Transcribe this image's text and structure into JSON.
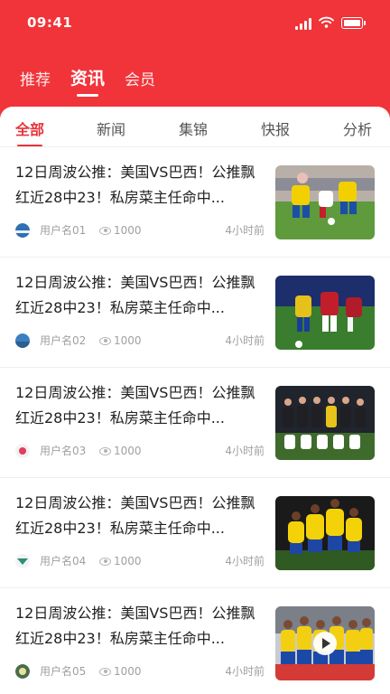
{
  "status_bar": {
    "time": "09:41"
  },
  "top_tabs": [
    {
      "label": "推荐",
      "active": false
    },
    {
      "label": "资讯",
      "active": true
    },
    {
      "label": "会员",
      "active": false
    }
  ],
  "categories": [
    {
      "label": "全部",
      "active": true
    },
    {
      "label": "新闻",
      "active": false
    },
    {
      "label": "集锦",
      "active": false
    },
    {
      "label": "快报",
      "active": false
    },
    {
      "label": "分析",
      "active": false
    }
  ],
  "articles": [
    {
      "title": "12日周波公推：美国VS巴西！公推飘红近28中23！私房菜主任命中...",
      "user": "用户名01",
      "views": "1000",
      "time": "4小时前",
      "thumb": "soccer-yellow-players",
      "video": false
    },
    {
      "title": "12日周波公推：美国VS巴西！公推飘红近28中23！私房菜主任命中...",
      "user": "用户名02",
      "views": "1000",
      "time": "4小时前",
      "thumb": "soccer-red-vs-yellow",
      "video": false
    },
    {
      "title": "12日周波公推：美国VS巴西！公推飘红近28中23！私房菜主任命中...",
      "user": "用户名03",
      "views": "1000",
      "time": "4小时前",
      "thumb": "team-photo",
      "video": false
    },
    {
      "title": "12日周波公推：美国VS巴西！公推飘红近28中23！私房菜主任命中...",
      "user": "用户名04",
      "views": "1000",
      "time": "4小时前",
      "thumb": "celebration-huddle",
      "video": false
    },
    {
      "title": "12日周波公推：美国VS巴西！公推飘红近28中23！私房菜主任命中...",
      "user": "用户名05",
      "views": "1000",
      "time": "4小时前",
      "thumb": "team-celebration",
      "video": true
    }
  ],
  "colors": {
    "brand_red": "#f0343a",
    "active_red": "#e8333a"
  }
}
